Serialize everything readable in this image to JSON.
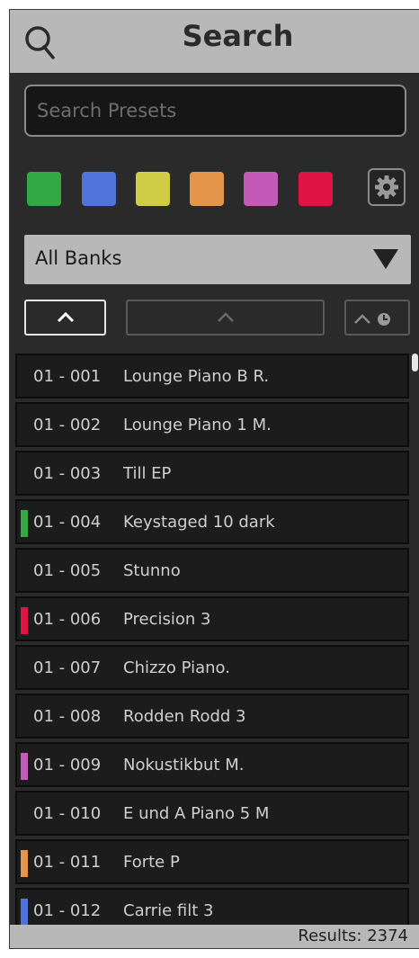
{
  "header": {
    "title": "Search",
    "icon": "search-icon"
  },
  "search": {
    "placeholder": "Search Presets",
    "value": ""
  },
  "color_filters": [
    {
      "name": "green",
      "color": "#33a845"
    },
    {
      "name": "blue",
      "color": "#4f73d8"
    },
    {
      "name": "yellow",
      "color": "#d0cc45"
    },
    {
      "name": "orange",
      "color": "#e5954a"
    },
    {
      "name": "magenta",
      "color": "#c45ab7"
    },
    {
      "name": "red",
      "color": "#e01443"
    }
  ],
  "settings": {
    "icon": "gear-icon"
  },
  "bank_filter": {
    "selected": "All Banks",
    "icon": "caret-down-icon"
  },
  "sort_buttons": [
    {
      "name": "sort-by-number",
      "icon": "chevron-up-icon",
      "active": true
    },
    {
      "name": "sort-by-name",
      "icon": "chevron-up-icon",
      "active": false
    },
    {
      "name": "sort-by-recent",
      "icon": "chevron-up-clock-icon",
      "active": false
    }
  ],
  "presets": [
    {
      "number": "01 - 001",
      "name": "Lounge Piano B R.",
      "tag": ""
    },
    {
      "number": "01 - 002",
      "name": "Lounge Piano 1 M.",
      "tag": ""
    },
    {
      "number": "01 - 003",
      "name": "Till EP",
      "tag": ""
    },
    {
      "number": "01 - 004",
      "name": "Keystaged 10 dark",
      "tag": "#33a845"
    },
    {
      "number": "01 - 005",
      "name": "Stunno",
      "tag": ""
    },
    {
      "number": "01 - 006",
      "name": "Precision 3",
      "tag": "#e01443"
    },
    {
      "number": "01 - 007",
      "name": "Chizzo Piano.",
      "tag": ""
    },
    {
      "number": "01 - 008",
      "name": "Rodden Rodd 3",
      "tag": ""
    },
    {
      "number": "01 - 009",
      "name": "Nokustikbut M.",
      "tag": "#c45ab7"
    },
    {
      "number": "01 - 010",
      "name": "E und A Piano 5 M",
      "tag": ""
    },
    {
      "number": "01 - 011",
      "name": "Forte P",
      "tag": "#e5954a"
    },
    {
      "number": "01 - 012",
      "name": "Carrie filt 3",
      "tag": "#4f73d8"
    }
  ],
  "footer": {
    "results": "Results: 2374"
  }
}
